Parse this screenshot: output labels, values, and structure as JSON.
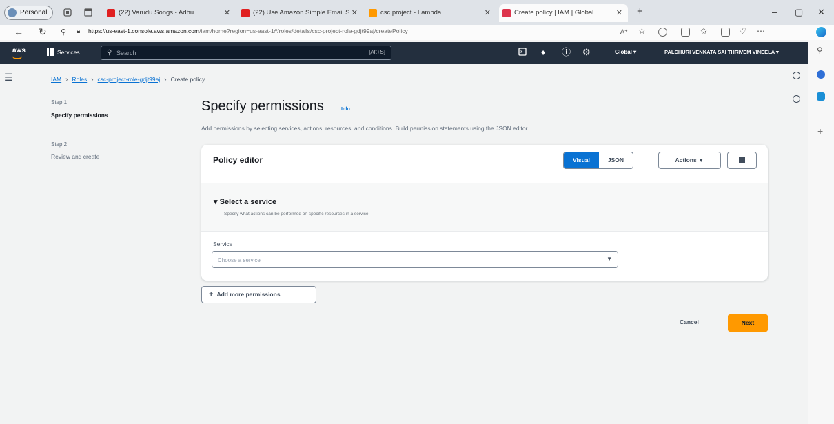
{
  "browser": {
    "profile_label": "Personal",
    "tabs": [
      {
        "title": "(22) Varudu Songs - Adhu",
        "favicon_color": "#e02020"
      },
      {
        "title": "(22) Use Amazon Simple Email S",
        "favicon_color": "#e02020"
      },
      {
        "title": "csc project - Lambda",
        "favicon_color": "#ff9900"
      },
      {
        "title": "Create policy | IAM | Global",
        "favicon_color": "#dd344c",
        "active": true
      }
    ],
    "new_tab": "+",
    "window_controls": [
      "–",
      "▢",
      "✕"
    ],
    "url_host": "https://us-east-1.console.aws.amazon.com",
    "url_path": "/iam/home?region=us-east-1#/roles/details/csc-project-role-gdjt99aj/createPolicy",
    "reader_label": "A⁺"
  },
  "aws_nav": {
    "logo": "aws",
    "services_label": "Services",
    "search_placeholder": "Search",
    "search_shortcut": "[Alt+S]",
    "region": "Global ▾",
    "account": "PALCHURI VENKATA SAI THRIVEM VINEELA ▾"
  },
  "breadcrumbs": {
    "iam": "IAM",
    "roles": "Roles",
    "role": "csc-project-role-gdjt99aj",
    "current": "Create policy",
    "separator": "›"
  },
  "steps": [
    {
      "label": "Step 1",
      "title": "Specify permissions"
    },
    {
      "label": "Step 2",
      "title": "Review and create"
    }
  ],
  "page": {
    "title": "Specify permissions",
    "info": "Info",
    "description": "Add permissions by selecting services, actions, resources, and conditions. Build permission statements using the JSON editor."
  },
  "editor": {
    "title": "Policy editor",
    "toggle_visual": "Visual",
    "toggle_json": "JSON",
    "actions": "Actions ▼",
    "select_service_title": "▾  Select a service",
    "select_service_desc": "Specify what actions can be performed on specific resources in a service.",
    "service_label": "Service",
    "service_placeholder": "Choose a service"
  },
  "buttons": {
    "add_more": "Add more permissions",
    "add_more_icon": "+",
    "cancel": "Cancel",
    "next": "Next"
  },
  "colors": {
    "aws_nav_bg": "#232f3e",
    "primary": "#0972d3",
    "orange": "#ff9900"
  }
}
